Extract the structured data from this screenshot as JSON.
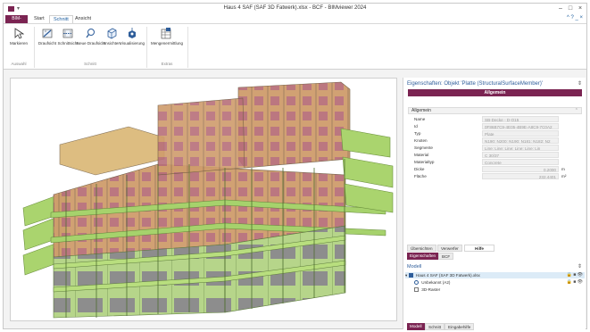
{
  "window": {
    "title": "Haus 4 SAF (SAF 3D Fatwerk).xlsx - BCF - BIMviewer 2024",
    "controls": {
      "minimize": "–",
      "maximize": "□",
      "close": "×"
    },
    "help": "^ ? _ ×"
  },
  "ribbon": {
    "app_tab": "BIM-Viewer",
    "tabs": [
      "Start",
      "Schnitt",
      "Ansicht"
    ],
    "active_tab": "Schnitt",
    "buttons": [
      {
        "label": "Markieren",
        "icon": "cursor-icon"
      },
      {
        "label": "Draufsicht",
        "icon": "draufsicht-icon"
      },
      {
        "label": "Schnittsicht",
        "icon": "schnittsicht-icon"
      },
      {
        "label": "Neue Draufsicht",
        "icon": "neue-draufsicht-icon"
      },
      {
        "label": "Ansichten",
        "icon": "ansichten-icon"
      },
      {
        "label": "Visualisierung",
        "icon": "visualisierung-icon"
      },
      {
        "label": "Mengenermittlung",
        "icon": "mengenermittlung-icon"
      }
    ],
    "groups": [
      "Auswahl",
      "Schnitt",
      "Extras"
    ]
  },
  "properties": {
    "title": "Eigenschaften: Objekt 'Platte (StructuralSurfaceMember)'",
    "category_bar": "Allgemein",
    "group": "Allgemein",
    "rows": [
      {
        "key": "Name",
        "value": "SB-Decke - D-O15"
      },
      {
        "key": "Id",
        "value": "0F86B7C9-4E05-4B9E-A8C9-7C0A2"
      },
      {
        "key": "Typ",
        "value": "Plate"
      },
      {
        "key": "Knoten",
        "value": "N190; N200; N190; N181; N182; N2"
      },
      {
        "key": "Segmente",
        "value": "Line; Line; Line; Line; Line; Lin"
      },
      {
        "key": "Material",
        "value": "C 30/37"
      },
      {
        "key": "Materialtyp",
        "value": "Concrete"
      },
      {
        "key": "Dicke",
        "value": "0.2000",
        "unit": "m"
      },
      {
        "key": "Fläche",
        "value": "232.4401",
        "unit": "m²"
      }
    ],
    "tabs_top": [
      "Übersichten",
      "Verwerfer",
      "Hilfe"
    ],
    "tabs_top_selected": "Hilfe",
    "tabs_bottom": [
      "Eigenschaften",
      "BCF"
    ],
    "tabs_bottom_selected": "Eigenschaften"
  },
  "model": {
    "title": "Modell",
    "tree": [
      {
        "label": "Haus 4 SAF (SAF 3D Fatwerk).xlsx",
        "level": 0
      },
      {
        "label": "Unbekannt (A2)",
        "level": 1
      },
      {
        "label": "3D-Raster",
        "level": 1
      }
    ],
    "tabs": [
      "Modell",
      "Schnitt",
      "Eingabehilfe"
    ],
    "tabs_selected": "Modell"
  },
  "colors": {
    "brand": "#7b2452",
    "accent_blue": "#2e5d9a",
    "slab_green": "#a9d86e",
    "wall_brown": "#c89a68",
    "opening_red": "#c47a80",
    "opening_gray": "#8d8d8d"
  }
}
